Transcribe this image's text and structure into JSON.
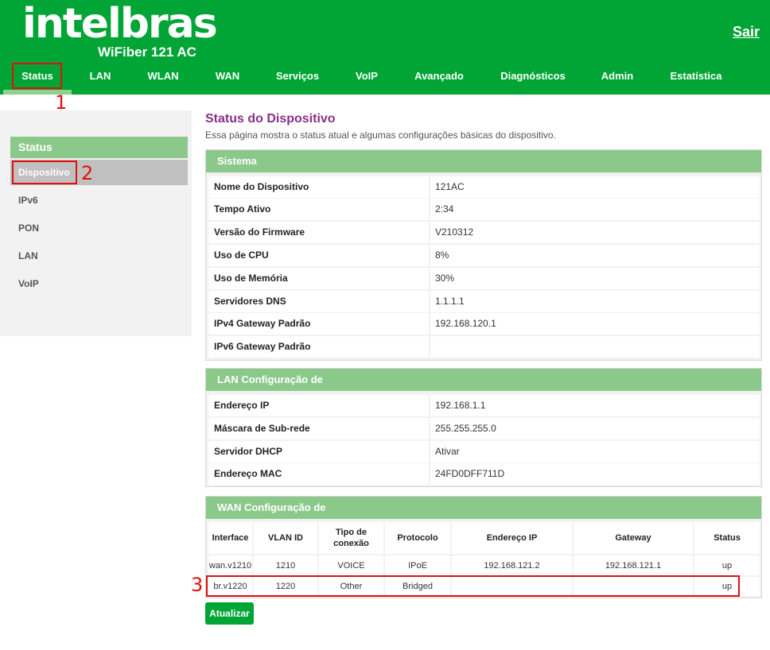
{
  "header": {
    "logo": "intelbras",
    "model": "WiFiber 121 AC",
    "logout_label": "Sair",
    "nav": [
      "Status",
      "LAN",
      "WLAN",
      "WAN",
      "Serviços",
      "VoIP",
      "Avançado",
      "Diagnósticos",
      "Admin",
      "Estatística"
    ],
    "active_nav": "Status"
  },
  "annotations": [
    "1",
    "2",
    "3"
  ],
  "sidebar": {
    "heading": "Status",
    "items": [
      "Dispositivo",
      "IPv6",
      "PON",
      "LAN",
      "VoIP"
    ],
    "active": "Dispositivo"
  },
  "page": {
    "title": "Status do Dispositivo",
    "description": "Essa página mostra o status atual e algumas configurações básicas do dispositivo."
  },
  "sistema": {
    "title": "Sistema",
    "rows": [
      {
        "key": "Nome do Dispositivo",
        "value": "121AC"
      },
      {
        "key": "Tempo Ativo",
        "value": "2:34"
      },
      {
        "key": "Versão do Firmware",
        "value": "V210312"
      },
      {
        "key": "Uso de CPU",
        "value": "8%"
      },
      {
        "key": "Uso de Memória",
        "value": "30%"
      },
      {
        "key": "Servidores DNS",
        "value": "1.1.1.1"
      },
      {
        "key": "IPv4 Gateway Padrão",
        "value": "192.168.120.1"
      },
      {
        "key": "IPv6 Gateway Padrão",
        "value": ""
      }
    ]
  },
  "lan": {
    "title": "LAN Configuração de",
    "rows": [
      {
        "key": "Endereço IP",
        "value": "192.168.1.1"
      },
      {
        "key": "Máscara de Sub-rede",
        "value": "255.255.255.0"
      },
      {
        "key": "Servidor DHCP",
        "value": "Ativar"
      },
      {
        "key": "Endereço MAC",
        "value": "24FD0DFF711D"
      }
    ]
  },
  "wan": {
    "title": "WAN Configuração de",
    "headers": [
      "Interface",
      "VLAN ID",
      "Tipo de conexão",
      "Protocolo",
      "Endereço IP",
      "Gateway",
      "Status"
    ],
    "rows": [
      [
        "wan.v1210",
        "1210",
        "VOICE",
        "IPoE",
        "192.168.121.2",
        "192.168.121.1",
        "up"
      ],
      [
        "br.v1220",
        "1220",
        "Other",
        "Bridged",
        "",
        "",
        "up"
      ]
    ]
  },
  "refresh_label": "Atualizar",
  "colors": {
    "brand_green": "#00a535",
    "section_header": "#8bc98b",
    "title_purple": "#8a2d8a",
    "annotation_red": "#e01010"
  }
}
